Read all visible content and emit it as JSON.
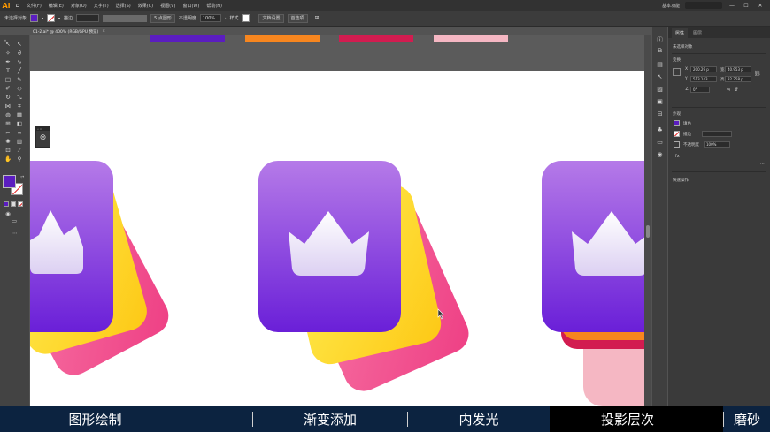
{
  "menubar": {
    "logo": "Ai",
    "items": [
      "文件(F)",
      "编辑(E)",
      "对象(O)",
      "文字(T)",
      "选择(S)",
      "效果(C)",
      "视图(V)",
      "窗口(W)",
      "帮助(H)"
    ],
    "workspace": "基本功能"
  },
  "controlbar": {
    "selection": "未选择对象",
    "stroke_label": "描边",
    "brush": "5 点圆形",
    "opacity_label": "不透明度",
    "opacity_value": "100%",
    "style_label": "样式",
    "doc_setup": "文档设置",
    "prefs": "首选项"
  },
  "document": {
    "tab_title": "01-2.ai* @ 400% (RGB/GPU 预览)",
    "strip_colors": [
      "#5b1dc0",
      "#f7861f",
      "#d21c50",
      "#f5b7c3"
    ]
  },
  "toolbar": {
    "fill_color": "#5b1dc0",
    "stroke_color": "#ffffff"
  },
  "panel": {
    "tab_properties": "属性",
    "tab_layers": "图层",
    "selection_state": "未选择对象",
    "transform_title": "变换",
    "x_label": "X",
    "x_value": "200.29 p",
    "y_label": "Y",
    "y_value": "513.143",
    "w_label": "宽",
    "w_value": "40.953 p",
    "h_label": "高",
    "h_value": "32.258 p",
    "angle_value": "0°",
    "appearance_title": "外观",
    "fill_label": "填色",
    "stroke_label": "描边",
    "opacity_label": "不透明度",
    "opacity_value": "100%",
    "quick_actions_title": "快速操作"
  },
  "lesson_bar": {
    "items": [
      "图形绘制",
      "渐变添加",
      "内发光",
      "投影层次",
      "磨砂"
    ],
    "active_index": 3
  },
  "colors": {
    "purple_top": "#b57ae8",
    "purple_bottom": "#6a1fd8",
    "yellow": "#fde21a",
    "pink": "#f55a92",
    "crown": "#e9e2f8"
  }
}
